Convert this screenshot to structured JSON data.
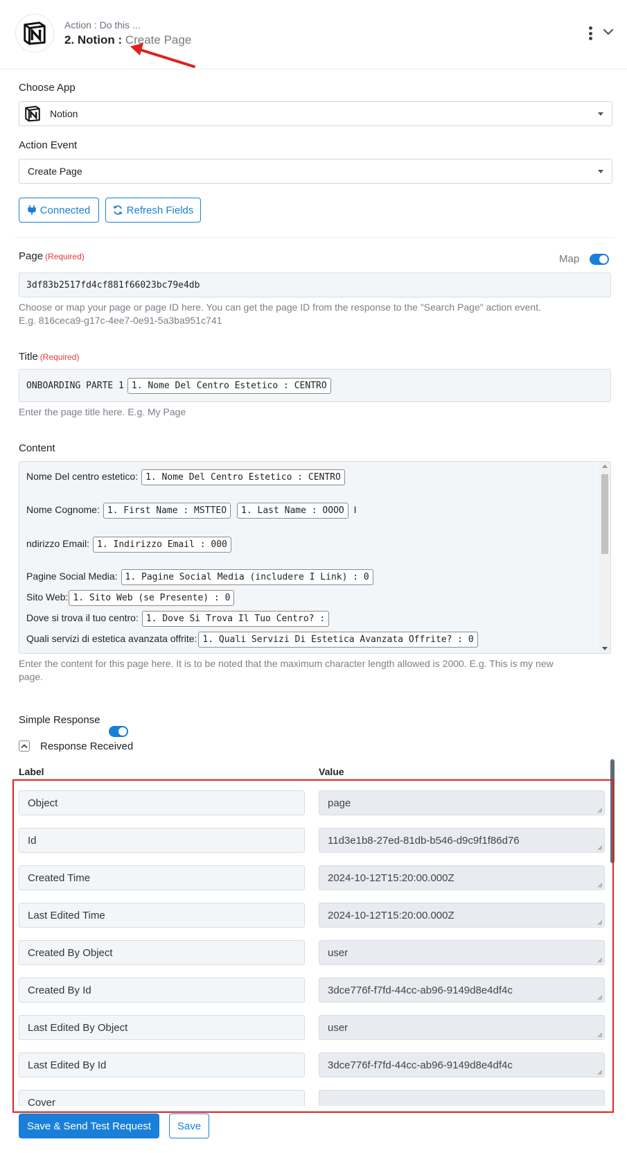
{
  "header": {
    "kicker": "Action : Do this ...",
    "step_app": "2. Notion : ",
    "event": "Create Page"
  },
  "choose_app": {
    "label": "Choose App",
    "value": "Notion"
  },
  "action_event": {
    "label": "Action Event",
    "value": "Create Page"
  },
  "buttons": {
    "connected": "Connected",
    "refresh": "Refresh Fields"
  },
  "page_field": {
    "label": "Page",
    "required": "(Required)",
    "map_label": "Map",
    "value": "3df83b2517fd4cf881f66023bc79e4db",
    "hint_line1": "Choose or map your page or page ID here. You can get the page ID from the response to the \"Search Page\" action event.",
    "hint_line2": "E.g. 816ceca9-g17c-4ee7-0e91-5a3ba951c741"
  },
  "title_field": {
    "label": "Title",
    "required": "(Required)",
    "prefix": "ONBOARDING PARTE 1",
    "token": "1. Nome Del Centro Estetico : CENTRO",
    "hint": "Enter the page title here. E.g. My Page"
  },
  "content_field": {
    "label": "Content",
    "rows": [
      {
        "text": "Nome Del centro estetico:",
        "tokens": [
          "1. Nome Del Centro Estetico : CENTRO"
        ],
        "trail": ""
      },
      {
        "text": "Nome Cognome:",
        "tokens": [
          "1. First Name : MSTTEO",
          "1. Last Name : OOOO"
        ],
        "trail": "I"
      },
      {
        "text": "ndirizzo Email:",
        "tokens": [
          "1. Indirizzo Email : 000"
        ],
        "trail": ""
      },
      {
        "text": "Pagine Social Media:",
        "tokens": [
          "1. Pagine Social Media (includere I Link) : 0"
        ],
        "trail": ""
      },
      {
        "text": "Sito Web:",
        "tokens": [
          "1. Sito Web (se Presente) : 0"
        ],
        "trail": ""
      },
      {
        "text": "Dove si trova il tuo centro:",
        "tokens": [
          "1. Dove Si Trova Il Tuo Centro? :"
        ],
        "trail": ""
      },
      {
        "text": "Quali servizi di estetica avanzata offrite:",
        "tokens": [
          "1. Quali Servizi Di Estetica Avanzata Offrite? : 0"
        ],
        "trail": ""
      }
    ],
    "hint_line1": "Enter the content for this page here. It is to be noted that the maximum character length allowed is 2000. E.g. This is my new",
    "hint_line2": "page."
  },
  "simple_response": {
    "label": "Simple Response"
  },
  "response_received": {
    "label": "Response Received"
  },
  "response_table": {
    "col_label": "Label",
    "col_value": "Value",
    "rows": [
      {
        "label": "Object",
        "value": "page"
      },
      {
        "label": "Id",
        "value": "11d3e1b8-27ed-81db-b546-d9c9f1f86d76"
      },
      {
        "label": "Created Time",
        "value": "2024-10-12T15:20:00.000Z"
      },
      {
        "label": "Last Edited Time",
        "value": "2024-10-12T15:20:00.000Z"
      },
      {
        "label": "Created By Object",
        "value": "user"
      },
      {
        "label": "Created By Id",
        "value": "3dce776f-f7fd-44cc-ab96-9149d8e4df4c"
      },
      {
        "label": "Last Edited By Object",
        "value": "user"
      },
      {
        "label": "Last Edited By Id",
        "value": "3dce776f-f7fd-44cc-ab96-9149d8e4df4c"
      },
      {
        "label": "Cover",
        "value": ""
      }
    ]
  },
  "footer": {
    "save_send": "Save & Send Test Request",
    "save": "Save"
  },
  "colors": {
    "accent": "#1a7fd9",
    "annotation_red": "#e02020"
  }
}
